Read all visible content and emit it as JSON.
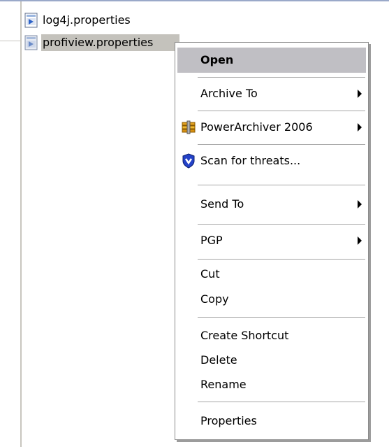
{
  "files": [
    {
      "name": "log4j.properties",
      "icon": "properties-file-icon",
      "selected": false
    },
    {
      "name": "profiview.properties",
      "icon": "properties-file-icon",
      "selected": true
    }
  ],
  "context_menu": {
    "items": {
      "open": {
        "label": "Open",
        "highlighted": true,
        "bold": true
      },
      "archive_to": {
        "label": "Archive To",
        "has_submenu": true
      },
      "powerarchiver": {
        "label": "PowerArchiver 2006",
        "has_submenu": true,
        "icon": "powerarchiver-icon"
      },
      "scan": {
        "label": "Scan for threats...",
        "icon": "shield-icon"
      },
      "send_to": {
        "label": "Send To",
        "has_submenu": true
      },
      "pgp": {
        "label": "PGP",
        "has_submenu": true
      },
      "cut": {
        "label": "Cut"
      },
      "copy": {
        "label": "Copy"
      },
      "create_shortcut": {
        "label": "Create Shortcut"
      },
      "delete": {
        "label": "Delete"
      },
      "rename": {
        "label": "Rename"
      },
      "properties": {
        "label": "Properties"
      }
    }
  },
  "colors": {
    "selection": "#c4c2bc",
    "menu_highlight": "#c0bfc4",
    "shield": "#2442c8"
  }
}
